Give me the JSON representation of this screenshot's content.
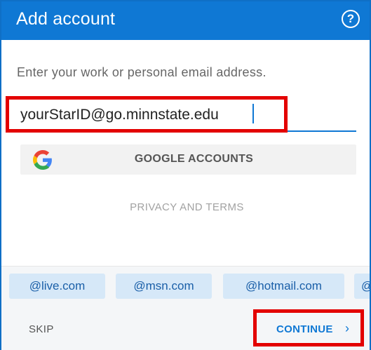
{
  "header": {
    "title": "Add account",
    "help_icon": "?"
  },
  "prompt": "Enter your work or personal email address.",
  "email": {
    "value": "yourStarID@go.minnstate.edu"
  },
  "google": {
    "label": "GOOGLE ACCOUNTS",
    "icon": "google-g-logo"
  },
  "privacy_link": "PRIVACY AND TERMS",
  "domain_chips": [
    "@live.com",
    "@msn.com",
    "@hotmail.com",
    "@"
  ],
  "footer": {
    "skip_label": "SKIP",
    "continue_label": "CONTINUE",
    "continue_chevron": "›"
  },
  "colors": {
    "accent": "#0f78d4",
    "highlight": "#e30000",
    "chip_bg": "#d6e8f8"
  }
}
